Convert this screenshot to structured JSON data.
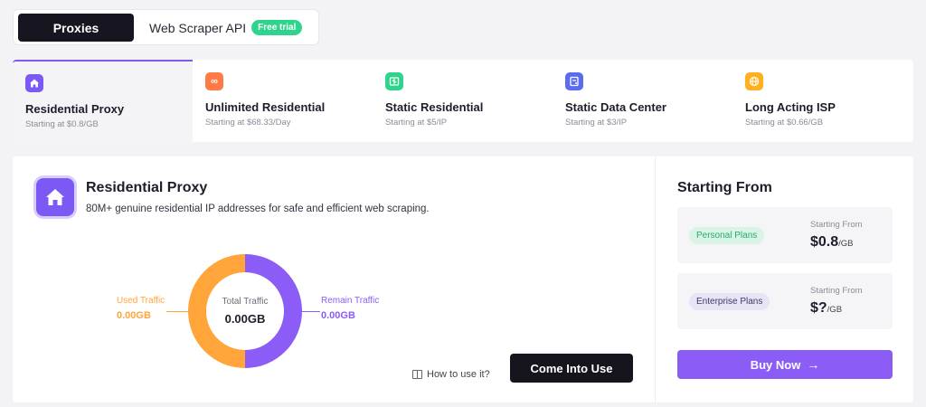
{
  "toggle": {
    "proxies": "Proxies",
    "scraper": "Web Scraper API",
    "free_badge": "Free trial"
  },
  "tabs": [
    {
      "title": "Residential Proxy",
      "sub": "Starting at $0.8/GB",
      "icon": "home-icon",
      "color": "#7c58f4"
    },
    {
      "title": "Unlimited Residential",
      "sub": "Starting at $68.33/Day",
      "icon": "infinity-icon",
      "color": "#ff7a45"
    },
    {
      "title": "Static Residential",
      "sub": "Starting at $5/IP",
      "icon": "static-icon",
      "color": "#2ed38c"
    },
    {
      "title": "Static Data Center",
      "sub": "Starting at $3/IP",
      "icon": "server-icon",
      "color": "#5b6cf0"
    },
    {
      "title": "Long Acting ISP",
      "sub": "Starting at $0.66/GB",
      "icon": "globe-icon",
      "color": "#ffb01f"
    }
  ],
  "main": {
    "title": "Residential Proxy",
    "description": "80M+ genuine residential IP addresses for safe and efficient web scraping.",
    "total_label": "Total Traffic",
    "total_value": "0.00GB",
    "used_label": "Used Traffic",
    "used_value": "0.00GB",
    "remain_label": "Remain Traffic",
    "remain_value": "0.00GB",
    "howto": "How to use it?",
    "cta": "Come Into Use"
  },
  "side": {
    "title": "Starting From",
    "plans": [
      {
        "name": "Personal Plans",
        "from": "Starting From",
        "price": "$0.8",
        "unit": "/GB"
      },
      {
        "name": "Enterprise Plans",
        "from": "Starting From",
        "price": "$?",
        "unit": "/GB"
      }
    ],
    "buy": "Buy Now",
    "buy_arrow": "→"
  },
  "colors": {
    "accent": "#8b5cf6",
    "used": "#ffa53a",
    "dark": "#16141d"
  }
}
